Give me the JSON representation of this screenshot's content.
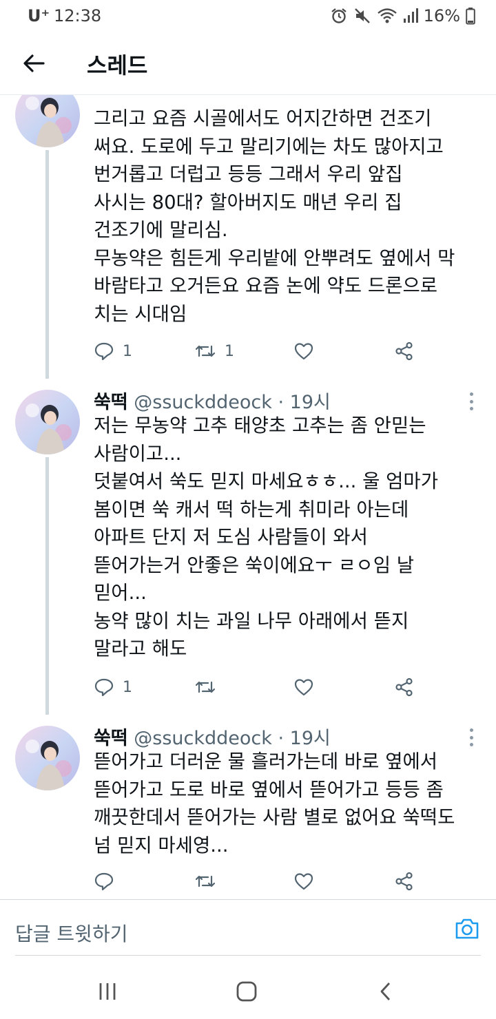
{
  "status_bar": {
    "carrier": "U⁺",
    "time": "12:38",
    "battery_text": "16%",
    "icons": [
      "alarm-icon",
      "mute-icon",
      "wifi-icon",
      "signal-icon",
      "battery-icon"
    ]
  },
  "header": {
    "title": "스레드",
    "back_icon": "arrow-left-icon"
  },
  "tweets": [
    {
      "name": "",
      "handle": "",
      "time": "",
      "lines": [
        "그리고 요즘 시골에서도 어지간하면 건조기",
        "써요. 도로에 두고 말리기에는 차도 많아지고",
        "번거롭고 더럽고 등등 그래서 우리 앞집",
        "사시는 80대? 할아버지도 매년 우리 집",
        "건조기에 말리심.",
        "무농약은 힘든게 우리밭에 안뿌려도 옆에서 막",
        "바람타고 오거든요 요즘 논에 약도 드론으로",
        "치는 시대임"
      ],
      "reply_count": "1",
      "retweet_count": "1"
    },
    {
      "name": "쑥떡",
      "handle": "@ssuckddeock",
      "time": "· 19시",
      "lines": [
        "저는 무농약 고추 태양초 고추는 좀 안믿는",
        "사람이고...",
        "덧붙여서 쑥도 믿지 마세요ㅎㅎ... 울 엄마가",
        "봄이면 쑥 캐서 떡 하는게 취미라 아는데",
        "아파트 단지 저 도심 사람들이 와서",
        "뜯어가는거 안좋은 쑥이에요ㅜ ㄹㅇ임 날",
        "믿어...",
        "농약 많이 치는 과일 나무 아래에서 뜯지",
        "말라고 해도"
      ],
      "reply_count": "1",
      "retweet_count": ""
    },
    {
      "name": "쑥떡",
      "handle": "@ssuckddeock",
      "time": "· 19시",
      "lines": [
        "뜯어가고 더러운 물 흘러가는데 바로 옆에서",
        "뜯어가고 도로 바로 옆에서 뜯어가고 등등 좀",
        "깨끗한데서 뜯어가는 사람 별로 없어요 쑥떡도",
        "넘 믿지 마세영..."
      ],
      "reply_count": "",
      "retweet_count": ""
    }
  ],
  "reply_bar": {
    "placeholder": "답글 트윗하기",
    "camera_icon": "camera-icon"
  },
  "nav_bar": {
    "icons": [
      "recent-apps-icon",
      "home-icon",
      "back-icon"
    ]
  },
  "colors": {
    "text": "#0f1419",
    "secondary": "#536471",
    "thread_line": "#cfd9de",
    "camera_accent": "#1d9bf0"
  }
}
